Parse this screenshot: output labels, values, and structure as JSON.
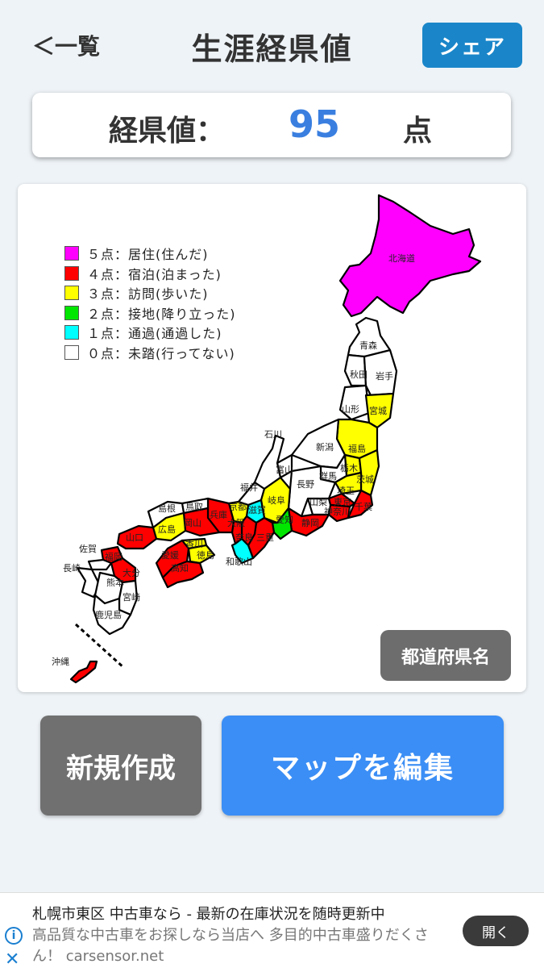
{
  "header": {
    "back_label": "＜一覧",
    "title": "生涯経県値",
    "share_label": "シェア"
  },
  "score": {
    "label": "経県値：",
    "value": "95",
    "unit": "点"
  },
  "legend": [
    {
      "color": "#ff00ff",
      "text": "５点：居住(住んだ)"
    },
    {
      "color": "#ff0000",
      "text": "４点：宿泊(泊まった)"
    },
    {
      "color": "#ffff00",
      "text": "３点：訪問(歩いた)"
    },
    {
      "color": "#00e600",
      "text": "２点：接地(降り立った)"
    },
    {
      "color": "#00ffff",
      "text": "１点：通過(通過した)"
    },
    {
      "color": "#ffffff",
      "text": "０点：未踏(行ってない)"
    }
  ],
  "prefectures": [
    "北海道",
    "青森",
    "秋田",
    "岩手",
    "山形",
    "宮城",
    "石川",
    "新潟",
    "福島",
    "富山",
    "群馬",
    "栃木",
    "茨城",
    "長野",
    "福井",
    "岐阜",
    "埼玉",
    "山梨",
    "東京",
    "千葉",
    "神奈川",
    "島根",
    "鳥取",
    "兵庫",
    "京都",
    "滋賀",
    "広島",
    "岡山",
    "大阪",
    "愛知",
    "静岡",
    "山口",
    "香川",
    "奈良",
    "三重",
    "佐賀",
    "福岡",
    "愛媛",
    "徳島",
    "和歌山",
    "長崎",
    "大分",
    "高知",
    "熊本",
    "宮崎",
    "鹿児島",
    "沖縄"
  ],
  "map_button_label": "都道府県名",
  "actions": {
    "new_label": "新規作成",
    "edit_label": "マップを編集"
  },
  "ad": {
    "title": "札幌市東区 中古車なら - 最新の在庫状況を随時更新中",
    "description": "高品質な中古車をお探しなら当店へ 多目的中古車盛りだくさん！ carsensor.net",
    "open_label": "開く"
  }
}
